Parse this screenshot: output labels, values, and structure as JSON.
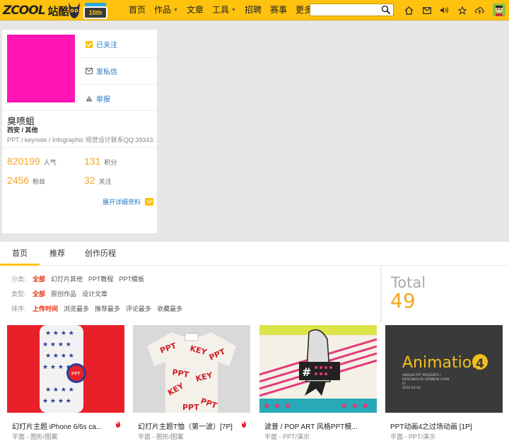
{
  "header": {
    "logo_text": "ZCOOL",
    "logo_cn": "站酷",
    "anniv_badge": "10th",
    "nav": [
      {
        "label": "首页",
        "caret": false
      },
      {
        "label": "作品",
        "caret": true
      },
      {
        "label": "文章",
        "caret": false
      },
      {
        "label": "工具",
        "caret": true
      },
      {
        "label": "招聘",
        "caret": false
      },
      {
        "label": "赛事",
        "caret": false
      },
      {
        "label": "更多",
        "caret": true
      }
    ],
    "search_placeholder": "",
    "icons": [
      "home-icon",
      "mail-icon",
      "sound-icon",
      "star-icon",
      "upload-icon"
    ]
  },
  "profile": {
    "actions": [
      "已关注",
      "发私信",
      "举报"
    ],
    "name": "臭喷蛆",
    "location": "西安 / 其他",
    "desc": "PPT / keynote / Infographic 视觉设计联系QQ:39343...",
    "stats": [
      {
        "num": "820199",
        "label": "人气"
      },
      {
        "num": "131",
        "label": "积分"
      },
      {
        "num": "2456",
        "label": "粉丝"
      },
      {
        "num": "32",
        "label": "关注"
      }
    ],
    "expand_label": "展开详细资料"
  },
  "tabs": [
    "首页",
    "推荐",
    "创作历程"
  ],
  "filters": {
    "rows": [
      {
        "label": "分类:",
        "options": [
          "全部",
          "幻灯片其他",
          "PPT教程",
          "PPT模板"
        ]
      },
      {
        "label": "类型:",
        "options": [
          "全部",
          "原创作品",
          "设计文章"
        ]
      },
      {
        "label": "排序:",
        "options": [
          "上传时间",
          "浏览最多",
          "推荐最多",
          "评论最多",
          "收藏最多"
        ]
      }
    ]
  },
  "total": {
    "label": "Total",
    "value": "49"
  },
  "works": [
    {
      "title": "幻灯片主题 iPhone 6/6s ca...",
      "meta": "平面 - 图形/图案",
      "hot": true
    },
    {
      "title": "幻灯片主题T恤（第一波）[7P]",
      "meta": "平面 - 图形/图案",
      "hot": true
    },
    {
      "title": "波普 / POP ART 风格PPT模...",
      "meta": "平面 - PPT/演示",
      "hot": false
    },
    {
      "title": "PPT动画4之过场动画 [1P]",
      "meta": "平面 - PPT/演示",
      "hot": false
    }
  ],
  "thumb4": {
    "title": "Animation",
    "num": "4",
    "lines": [
      "UNIQUE PPT PRESENTS /",
      "DESIGNED BY DENNON CHAN",
      "///",
      "2016.10.10"
    ]
  },
  "thumb3": {
    "badge": "#"
  }
}
